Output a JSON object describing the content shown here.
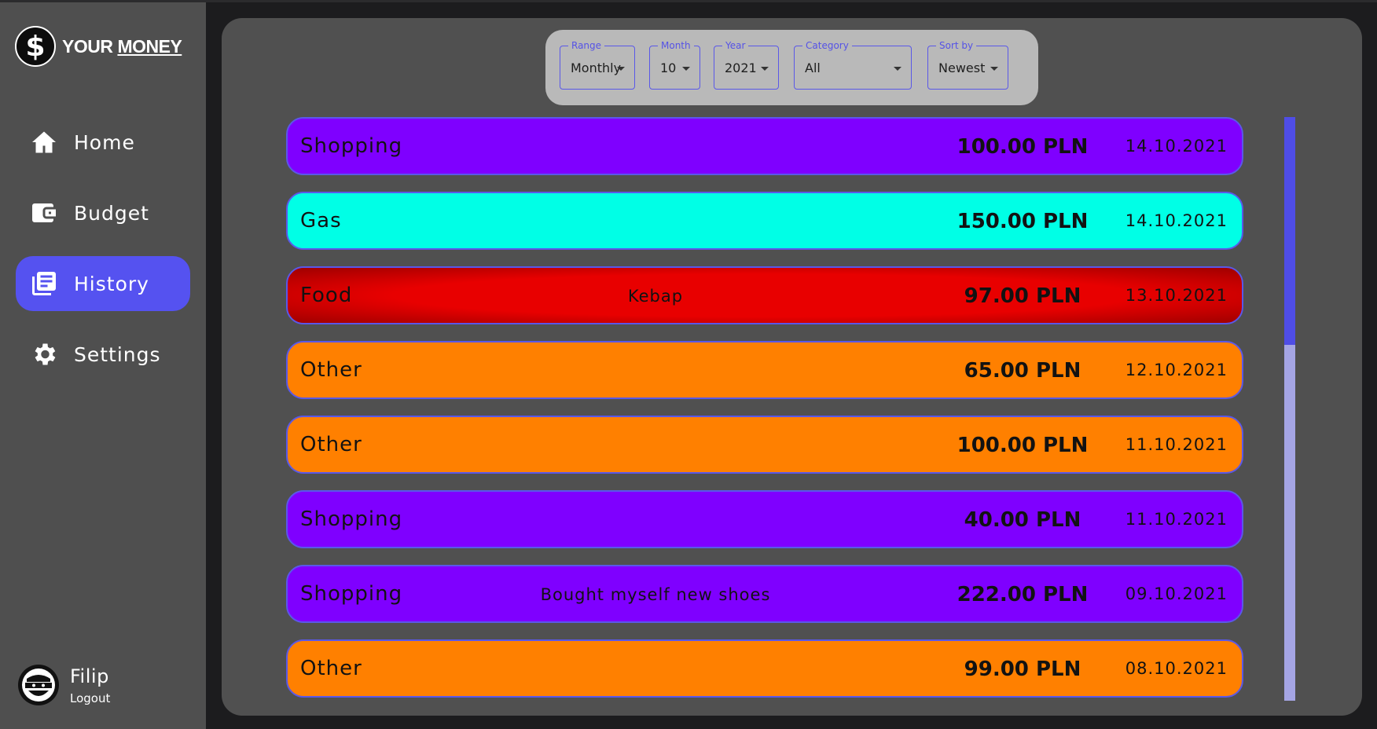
{
  "app": {
    "logo_symbol": "$",
    "title_a": "YOUR",
    "title_b": "MONEY"
  },
  "nav": [
    {
      "label": "Home",
      "icon": "home-icon"
    },
    {
      "label": "Budget",
      "icon": "wallet-icon"
    },
    {
      "label": "History",
      "icon": "history-icon",
      "active": true
    },
    {
      "label": "Settings",
      "icon": "gear-icon"
    }
  ],
  "user": {
    "name": "Filip",
    "logout": "Logout"
  },
  "filters": {
    "range": {
      "label": "Range",
      "value": "Monthly"
    },
    "month": {
      "label": "Month",
      "value": "10"
    },
    "year": {
      "label": "Year",
      "value": "2021"
    },
    "category": {
      "label": "Category",
      "value": "All"
    },
    "sort": {
      "label": "Sort by",
      "value": "Newest"
    }
  },
  "colors": {
    "accent": "#5552f0",
    "Shopping": "#7f00ff",
    "Gas": "#00ffe6",
    "Food": "#e80000",
    "Other": "#ff8000"
  },
  "transactions": [
    {
      "category": "Shopping",
      "description": "",
      "amount": "100.00 PLN",
      "date": "14.10.2021"
    },
    {
      "category": "Gas",
      "description": "",
      "amount": "150.00 PLN",
      "date": "14.10.2021"
    },
    {
      "category": "Food",
      "description": "Kebap",
      "amount": "97.00 PLN",
      "date": "13.10.2021"
    },
    {
      "category": "Other",
      "description": "",
      "amount": "65.00 PLN",
      "date": "12.10.2021"
    },
    {
      "category": "Other",
      "description": "",
      "amount": "100.00 PLN",
      "date": "11.10.2021"
    },
    {
      "category": "Shopping",
      "description": "",
      "amount": "40.00 PLN",
      "date": "11.10.2021"
    },
    {
      "category": "Shopping",
      "description": "Bought myself new shoes",
      "amount": "222.00 PLN",
      "date": "09.10.2021"
    },
    {
      "category": "Other",
      "description": "",
      "amount": "99.00 PLN",
      "date": "08.10.2021"
    }
  ]
}
